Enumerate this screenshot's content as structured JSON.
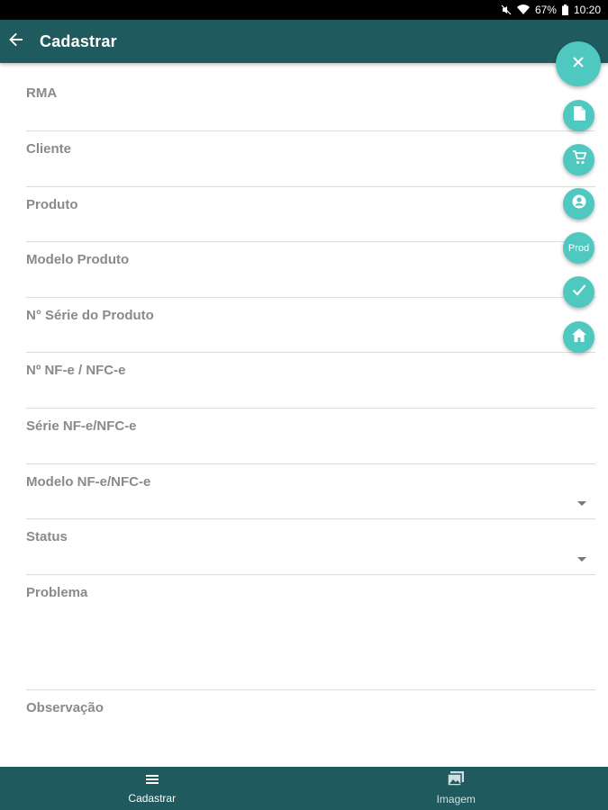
{
  "status_bar": {
    "battery_text": "67%",
    "time": "10:20",
    "icons": [
      "mute-icon",
      "wifi-icon",
      "battery-icon"
    ]
  },
  "app_bar": {
    "title": "Cadastrar",
    "back_icon": "arrow-left-icon"
  },
  "form": {
    "fields": [
      {
        "label": "RMA",
        "type": "text"
      },
      {
        "label": "Cliente",
        "type": "text"
      },
      {
        "label": "Produto",
        "type": "text"
      },
      {
        "label": "Modelo Produto",
        "type": "text"
      },
      {
        "label": "N° Série do Produto",
        "type": "text"
      },
      {
        "label": "Nº NF-e / NFC-e",
        "type": "text"
      },
      {
        "label": "Série NF-e/NFC-e",
        "type": "text"
      },
      {
        "label": "Modelo NF-e/NFC-e",
        "type": "dropdown"
      },
      {
        "label": "Status",
        "type": "dropdown"
      },
      {
        "label": "Problema",
        "type": "textarea"
      },
      {
        "label": "Observação",
        "type": "textarea"
      }
    ]
  },
  "fab_menu": {
    "main_icon": "close-icon",
    "actions": [
      {
        "icon": "document-icon"
      },
      {
        "icon": "cart-icon"
      },
      {
        "icon": "account-icon"
      },
      {
        "icon": "prod-text",
        "text": "Prod"
      },
      {
        "icon": "check-icon"
      },
      {
        "icon": "home-icon"
      }
    ]
  },
  "bottom_nav": {
    "items": [
      {
        "label": "Cadastrar",
        "icon": "list-icon",
        "active": true
      },
      {
        "label": "Imagem",
        "icon": "image-icon",
        "active": false
      }
    ]
  },
  "colors": {
    "primary": "#1f5a5e",
    "accent": "#4fc9bf",
    "label": "#8a8a8a",
    "divider": "#dcdcdc"
  }
}
